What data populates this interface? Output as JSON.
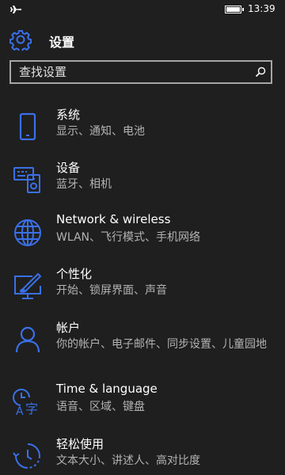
{
  "status": {
    "time": "13:39",
    "battery_level": 1.0,
    "airplane_mode": true
  },
  "header": {
    "title": "设置",
    "icon": "gear-icon"
  },
  "search": {
    "placeholder": "查找设置",
    "icon": "search-icon"
  },
  "accent_color": "#3a70e8",
  "items": [
    {
      "title": "系统",
      "subtitle": "显示、通知、电池",
      "icon": "phone-icon"
    },
    {
      "title": "设备",
      "subtitle": "蓝牙、相机",
      "icon": "devices-icon"
    },
    {
      "title": "Network & wireless",
      "subtitle": "WLAN、飞行模式、手机网络",
      "icon": "globe-icon"
    },
    {
      "title": "个性化",
      "subtitle": "开始、锁屏界面、声音",
      "icon": "personalization-icon"
    },
    {
      "title": "帐户",
      "subtitle": "你的帐户、电子邮件、同步设置、儿童园地",
      "icon": "person-icon"
    },
    {
      "title": "Time & language",
      "subtitle": "语音、区域、键盘",
      "icon": "time-language-icon"
    },
    {
      "title": "轻松使用",
      "subtitle": "文本大小、讲述人、高对比度",
      "icon": "ease-of-access-icon"
    }
  ]
}
